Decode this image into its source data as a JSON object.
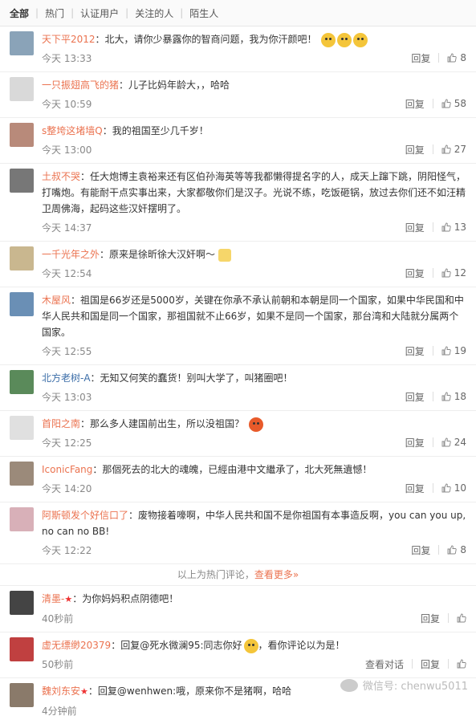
{
  "tabs": [
    "全部",
    "热门",
    "认证用户",
    "关注的人",
    "陌生人"
  ],
  "reply_label": "回复",
  "view_convo_label": "查看对话",
  "more": {
    "prefix": "以上为热门评论，",
    "link": "查看更多»"
  },
  "comments": [
    {
      "user": "天下平2012",
      "text": "：北大，请你少暴露你的智商问题，我为你汗颜吧！",
      "time": "今天 13:33",
      "likes": "8",
      "avatar_color": "#8aa3b8"
    },
    {
      "user": "一只振翅高飞的猪",
      "text": "：儿子比妈年龄大，，哈哈",
      "time": "今天 10:59",
      "likes": "58",
      "avatar_color": "#d9d9d9"
    },
    {
      "user": "s整垮这堵墙Q",
      "text": "：我的祖国至少几千岁！",
      "time": "今天 13:00",
      "likes": "27",
      "avatar_color": "#b88a7a"
    },
    {
      "user": "土叔不哭",
      "text": "：任大炮博主袁裕来还有区伯孙海英等等我都懒得提名字的人，成天上蹿下跳，阴阳怪气，打嘴炮。有能耐干点实事出来，大家都敬你们是汉子。光说不练，吃饭砸锅，放过去你们还不如汪精卫周佛海，起码这些汉奸摆明了。",
      "time": "今天 14:37",
      "likes": "13",
      "avatar_color": "#777777"
    },
    {
      "user": "一千光年之外",
      "text": "：原来是徐昕徐大汉奸啊～",
      "time": "今天 12:54",
      "likes": "12",
      "avatar_color": "#c9b78f"
    },
    {
      "user": "木屋风",
      "text": "：祖国是66岁还是5000岁，关键在你承不承认前朝和本朝是同一个国家，如果中华民国和中华人民共和国是同一个国家，那祖国就不止66岁，如果不是同一个国家，那台湾和大陆就分属两个国家。",
      "time": "今天 12:55",
      "likes": "19",
      "avatar_color": "#6a8fb5"
    },
    {
      "user": "北方老树-A",
      "text": "：无知又何笑的蠢货！别叫大学了，叫猪圈吧！",
      "time": "今天 13:03",
      "likes": "18",
      "avatar_color": "#5a8a5a"
    },
    {
      "user": "首阳之南",
      "text": "：那么多人建国前出生，所以没祖国？",
      "time": "今天 12:25",
      "likes": "24",
      "avatar_color": "#e0e0e0"
    },
    {
      "user": "IconicFang",
      "text": "：那個死去的北大的魂魄，已經由港中文繼承了，北大死無遺憾！",
      "time": "今天 14:20",
      "likes": "10",
      "avatar_color": "#9b8a7a"
    },
    {
      "user": "阿斯顿发个好信口了",
      "text": "：废物接着嚎啊，中华人民共和国不是你祖国有本事造反啊，you can you up,no can no BB!",
      "time": "今天 12:22",
      "likes": "8",
      "avatar_color": "#d8b0b8"
    },
    {
      "user": "清墨-",
      "text": "：为你妈妈积点阴德吧！",
      "time": "40秒前",
      "likes": "",
      "avatar_color": "#444444"
    },
    {
      "user": "虚无缥缈20379",
      "text": "：回复@死水微澜95:同志你好",
      "text2": "，看你评论以为是！",
      "time": "50秒前",
      "likes": "",
      "avatar_color": "#c04040"
    },
    {
      "user": "魏刘东安",
      "text": "：回复@wenhwen:哦，原来你不是猪啊，哈哈",
      "time": "4分钟前",
      "likes": "",
      "avatar_color": "#8a7a6a"
    }
  ],
  "watermark": "微信号: chenwu5011"
}
